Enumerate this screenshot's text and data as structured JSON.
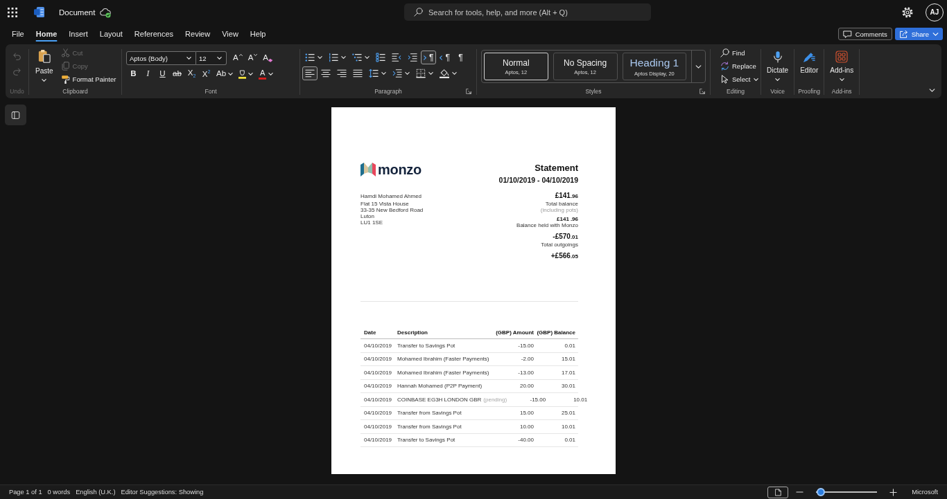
{
  "title_bar": {
    "document_name": "Document",
    "saved": true,
    "search": {
      "placeholder": "Search for tools, help, and more (Alt + Q)"
    },
    "account": {
      "initials": "AJ"
    }
  },
  "tabs": [
    {
      "label": "File",
      "selected": false
    },
    {
      "label": "Home",
      "selected": true
    },
    {
      "label": "Insert",
      "selected": false
    },
    {
      "label": "Layout",
      "selected": false
    },
    {
      "label": "References",
      "selected": false
    },
    {
      "label": "Review",
      "selected": false
    },
    {
      "label": "View",
      "selected": false
    },
    {
      "label": "Help",
      "selected": false
    }
  ],
  "tab_actions": [
    {
      "kind": "comments",
      "label": "Comments",
      "dropdown": false
    },
    {
      "kind": "share",
      "label": "Share",
      "dropdown": true
    }
  ],
  "ribbon": {
    "groups": [
      {
        "kind": "stack",
        "label": "Undo",
        "disabled": true,
        "launcher": false,
        "buttons": [
          {
            "kind": "undo",
            "disabled": true
          },
          {
            "kind": "redo",
            "disabled": true
          }
        ]
      },
      {
        "kind": "clipboard",
        "label": "Clipboard",
        "disabled": false,
        "launcher": false,
        "main": {
          "label": "Paste",
          "dropdown": true
        },
        "buttons": [
          {
            "kind": "cut",
            "label": "Cut",
            "disabled": true
          },
          {
            "kind": "copy",
            "label": "Copy",
            "disabled": true
          },
          {
            "kind": "painter",
            "label": "Format Painter",
            "disabled": false
          }
        ]
      },
      {
        "kind": "font",
        "label": "Font",
        "disabled": false,
        "launcher": false,
        "font_name": "Aptos (Body)",
        "font_size": "12",
        "rows": [
          [
            {
              "kind": "grow",
              "glyph": "A",
              "dropdown": false
            },
            {
              "kind": "shrink",
              "glyph": "A",
              "dropdown": false
            },
            {
              "kind": "clear",
              "glyph": "A",
              "dropdown": false
            }
          ],
          [
            {
              "kind": "bold",
              "glyph": "B",
              "dropdown": false
            },
            {
              "kind": "italic",
              "glyph": "I",
              "dropdown": false
            },
            {
              "kind": "underline",
              "glyph": "U",
              "dropdown": false
            },
            {
              "kind": "strike",
              "glyph": "ab",
              "dropdown": false
            },
            {
              "kind": "subscript",
              "glyph": "X$_{2}$",
              "dropdown": false
            },
            {
              "kind": "superscript",
              "glyph": "X$^{2}$",
              "dropdown": false
            },
            {
              "kind": "case",
              "glyph": "Ab",
              "dropdown": true
            },
            {
              "kind": "highlight",
              "dropdown": true
            },
            {
              "kind": "color",
              "glyph": "A",
              "dropdown": true
            }
          ]
        ]
      },
      {
        "kind": "paragraph",
        "label": "Paragraph",
        "disabled": false,
        "launcher": true,
        "rows": [
          [
            {
              "kind": "bullets",
              "dropdown": true,
              "selected": false
            },
            {
              "kind": "numbering",
              "dropdown": true,
              "selected": false
            },
            {
              "kind": "multilevel",
              "dropdown": true,
              "selected": false
            },
            {
              "kind": "checklist",
              "dropdown": false,
              "selected": false
            },
            {
              "kind": "outdent",
              "dropdown": false,
              "selected": false
            },
            {
              "kind": "indent",
              "dropdown": false,
              "selected": false
            },
            {
              "kind": "ltr",
              "glyph": "¶",
              "dropdown": false,
              "selected": true
            },
            {
              "kind": "rtl",
              "glyph": "¶",
              "dropdown": false,
              "selected": false
            },
            {
              "kind": "marks",
              "glyph": "¶",
              "dropdown": false,
              "selected": false
            }
          ],
          [
            {
              "kind": "left",
              "dropdown": false,
              "selected": true
            },
            {
              "kind": "center",
              "dropdown": false,
              "selected": false
            },
            {
              "kind": "right",
              "dropdown": false,
              "selected": false
            },
            {
              "kind": "justify",
              "dropdown": false,
              "selected": false
            },
            {
              "kind": "linespacing",
              "dropdown": true,
              "selected": false
            },
            {
              "kind": "spacing",
              "dropdown": true,
              "selected": false
            },
            {
              "kind": "borders",
              "dropdown": true,
              "selected": false
            },
            {
              "kind": "shading",
              "dropdown": true,
              "selected": false
            }
          ]
        ]
      },
      {
        "kind": "styles",
        "label": "Styles",
        "disabled": false,
        "launcher": true,
        "styles": [
          {
            "kind": "body",
            "name": "Normal",
            "font": "Aptos, 12",
            "selected": true
          },
          {
            "kind": "body",
            "name": "No Spacing",
            "font": "Aptos, 12",
            "selected": false
          },
          {
            "kind": "heading",
            "name": "Heading 1",
            "font": "Aptos Display, 20",
            "selected": false
          }
        ]
      },
      {
        "kind": "editing",
        "label": "Editing",
        "disabled": false,
        "launcher": false,
        "buttons": [
          {
            "kind": "find",
            "label": "Find",
            "dropdown": false
          },
          {
            "kind": "replace",
            "label": "Replace",
            "dropdown": false
          },
          {
            "kind": "select",
            "label": "Select",
            "dropdown": true
          }
        ]
      },
      {
        "kind": "large",
        "label": "Voice",
        "disabled": false,
        "launcher": false,
        "button": {
          "kind": "dictate",
          "label": "Dictate",
          "dropdown": true
        }
      },
      {
        "kind": "large",
        "label": "Proofing",
        "disabled": false,
        "launcher": false,
        "button": {
          "kind": "editor",
          "label": "Editor",
          "dropdown": false
        }
      },
      {
        "kind": "large",
        "label": "Add-ins",
        "disabled": false,
        "launcher": false,
        "button": {
          "kind": "addins",
          "label": "Add-ins",
          "dropdown": true
        }
      }
    ]
  },
  "document": {
    "logo": {
      "wordmark": "monzo"
    },
    "title": "Statement",
    "period": "01/10/2019 - 04/10/2019",
    "recipient": {
      "name": "Hamdi Mohamed Ahmed",
      "address": [
        "Flat 15 Vista House",
        "33-35 New Bedford Road",
        "Luton",
        "LU1 1SE"
      ]
    },
    "summary": [
      {
        "kind": "major",
        "amount": "£141",
        "fraction": ".96",
        "label": "Total balance",
        "note": "(including pots)"
      },
      {
        "kind": "minor",
        "amount": "£141",
        "fraction": ".96",
        "label": "Balance held with Monzo"
      },
      {
        "kind": "major",
        "amount": "-£570",
        "fraction": ".01",
        "label": "Total outgoings"
      },
      {
        "kind": "major",
        "amount": "+£566",
        "fraction": ".05"
      }
    ],
    "table": {
      "columns": [
        "Date",
        "Description",
        "(GBP) Amount",
        "(GBP) Balance"
      ],
      "rows": [
        {
          "date": "04/10/2019",
          "description": "Transfer to Savings Pot",
          "amount": "-15.00",
          "balance": "0.01"
        },
        {
          "date": "04/10/2019",
          "description": "Mohamed Ibrahim (Faster Payments)",
          "amount": "-2.00",
          "balance": "15.01"
        },
        {
          "date": "04/10/2019",
          "description": "Mohamed Ibrahim (Faster Payments)",
          "amount": "-13.00",
          "balance": "17.01"
        },
        {
          "date": "04/10/2019",
          "description": "Hannah Mohamed (P2P Payment)",
          "amount": "20.00",
          "balance": "30.01"
        },
        {
          "date": "04/10/2019",
          "description": "COINBASE EG3H LONDON GBR",
          "status": "(pending)",
          "amount": "-15.00",
          "balance": "10.01"
        },
        {
          "date": "04/10/2019",
          "description": "Transfer from Savings Pot",
          "amount": "15.00",
          "balance": "25.01"
        },
        {
          "date": "04/10/2019",
          "description": "Transfer from Savings Pot",
          "amount": "10.00",
          "balance": "10.01"
        },
        {
          "date": "04/10/2019",
          "description": "Transfer to Savings Pot",
          "amount": "-40.00",
          "balance": "0.01"
        }
      ]
    }
  },
  "status_bar": {
    "items": [
      "Page 1 of 1",
      "0 words",
      "English (U.K.)",
      "Editor Suggestions: Showing"
    ],
    "view_button": {
      "selected": true
    },
    "zoom": {
      "level": 0.08
    },
    "brand": "Microsoft"
  }
}
